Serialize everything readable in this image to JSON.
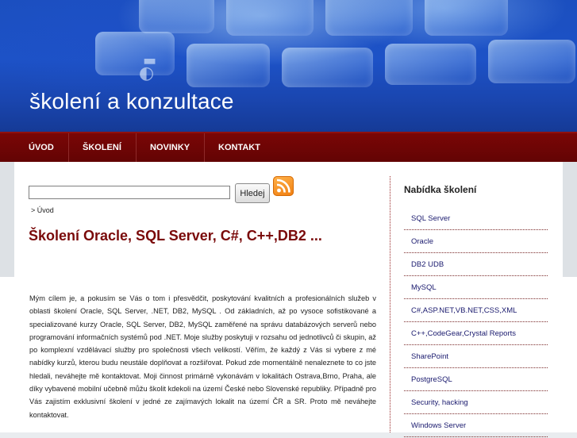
{
  "site": {
    "title": "školení a konzultace"
  },
  "nav": {
    "items": [
      "ÚVOD",
      "ŠKOLENÍ",
      "NOVINKY",
      "KONTAKT"
    ]
  },
  "search": {
    "value": "",
    "button_label": "Hledej"
  },
  "header_icons": [
    "rss-feed-icon"
  ],
  "breadcrumb": {
    "text": "> Úvod"
  },
  "page": {
    "title": "Školení Oracle, SQL Server, C#, C++,DB2 ...",
    "body": "Mým cílem je, a pokusím se Vás o tom i přesvědčit, poskytování kvalitních a profesionálních služeb v oblasti školení Oracle, SQL Server, .NET, DB2, MySQL . Od základních, až po vysoce sofistikované a specializované kurzy Oracle, SQL Server, DB2, MySQL zaměřené na správu databázových serverů nebo programování informačních systémů pod .NET. Moje služby poskytuji v rozsahu od jednotlivců či skupin, až po komplexní vzdělávací služby pro společnosti všech velikostí. Věřím, že každý z Vás si vybere z mé nabídky kurzů, kterou budu neustále doplňovat a rozšiřovat. Pokud zde momentálně nenaleznete to co jste hledali, neváhejte mě kontaktovat. Moji činnost primárně vykonávám v lokalitách Ostrava,Brno, Praha, ale díky vybavené mobilní učebně můžu školit kdekoli na území České nebo Slovenské republiky. Případně pro Vás zajistím exklusivní školení v jedné ze zajímavých lokalit na území ČR a SR. Proto mě neváhejte kontaktovat."
  },
  "sidebar": {
    "title": "Nabídka školení",
    "items": [
      "SQL Server",
      "Oracle",
      "DB2 UDB",
      "MySQL",
      "C#,ASP.NET,VB.NET,CSS,XML",
      "C++,CodeGear,Crystal Reports",
      "SharePoint",
      "PostgreSQL",
      "Security, hacking",
      "Windows Server"
    ]
  },
  "colors": {
    "header_blue": "#1d52c7",
    "nav_maroon": "#6e0505",
    "title_maroon": "#7a0a0a",
    "rss_orange": "#f58a1f",
    "link_navy": "#1a1a6e"
  }
}
